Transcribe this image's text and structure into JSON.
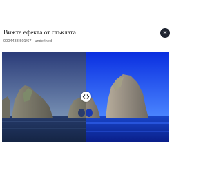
{
  "dialog": {
    "title": "Вижте ефекта от стъклата",
    "subtitle": "0004433 501/67 - undefined",
    "close_icon": "close-icon"
  },
  "viewer": {
    "handle_icon": "chevron-left-right-icon"
  },
  "colors": {
    "close_bg": "#1f2430",
    "title_text": "#1d1d1d",
    "subtitle_text": "#555555"
  }
}
